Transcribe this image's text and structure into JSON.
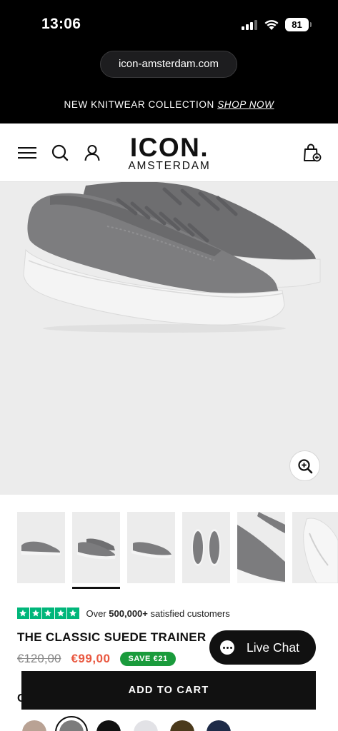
{
  "status_bar": {
    "time": "13:06",
    "battery": "81",
    "signal_icon": "cellular-signal-icon",
    "wifi_icon": "wifi-icon"
  },
  "browser": {
    "url": "icon-amsterdam.com"
  },
  "announcement": {
    "text": "NEW KNITWEAR COLLECTION",
    "link": "SHOP NOW"
  },
  "header": {
    "logo_main": "ICON.",
    "logo_sub": "AMSTERDAM",
    "icons": [
      "menu-icon",
      "search-icon",
      "account-icon",
      "cart-icon"
    ]
  },
  "hero": {
    "zoom_icon": "zoom-in-icon",
    "product_color": "#7a7a7c",
    "sole_color": "#f3f3f3"
  },
  "thumbnails": {
    "count": 6,
    "active_index": 1
  },
  "reviews": {
    "rating_stars": 5,
    "prefix": "Over",
    "count": "500,000+",
    "suffix": "satisfied customers",
    "star_color": "#00b67a"
  },
  "product": {
    "title": "THE CLASSIC SUEDE TRAINER",
    "old_price": "€120,00",
    "new_price": "€99,00",
    "save_badge": "SAVE €21"
  },
  "live_chat": {
    "label": "Live Chat"
  },
  "cart": {
    "button_label": "ADD TO CART"
  },
  "colors_section": {
    "label_peek": "C"
  },
  "swatches": {
    "colors": [
      "#b9a294",
      "#7c7c7c",
      "#111111",
      "#e2e2e6",
      "#4b3a1c",
      "#1e2b48"
    ],
    "selected_index": 1
  }
}
